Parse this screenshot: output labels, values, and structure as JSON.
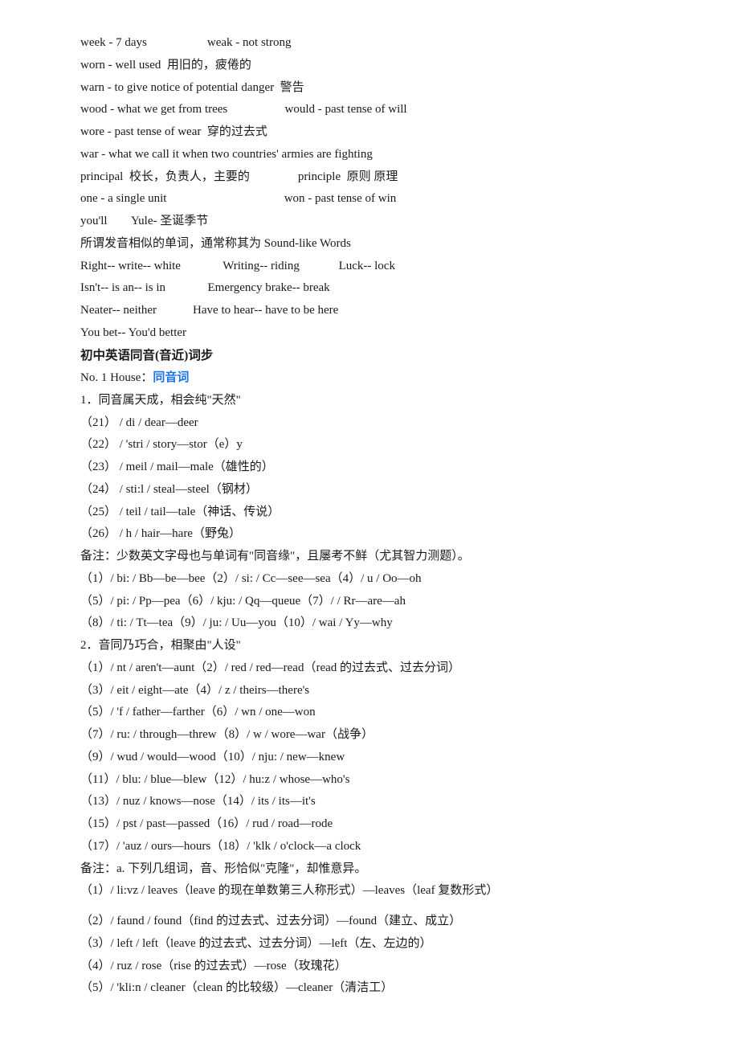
{
  "lines": [
    {
      "id": "l1",
      "text": "week - 7 days                    weak - not strong",
      "type": "normal"
    },
    {
      "id": "l2",
      "text": "worn - well used  用旧的，疲倦的",
      "type": "normal"
    },
    {
      "id": "l3",
      "text": "warn - to give notice of potential danger  警告",
      "type": "normal"
    },
    {
      "id": "l4",
      "text": "wood - what we get from trees                   would - past tense of will",
      "type": "normal"
    },
    {
      "id": "l5",
      "text": "wore - past tense of wear  穿的过去式",
      "type": "normal"
    },
    {
      "id": "l6",
      "text": "war - what we call it when two countries' armies are fighting",
      "type": "normal"
    },
    {
      "id": "l7",
      "text": "principal  校长，负责人，主要的                principle  原则 原理",
      "type": "normal"
    },
    {
      "id": "l8",
      "text": "one - a single unit                                       won - past tense of win",
      "type": "normal"
    },
    {
      "id": "l9",
      "text": "you'll        Yule- 圣诞季节",
      "type": "normal"
    },
    {
      "id": "l10",
      "text": "所谓发音相似的单词，通常称其为 Sound-like Words",
      "type": "normal"
    },
    {
      "id": "l11",
      "text": "Right-- write-- white              Writing-- riding             Luck-- lock",
      "type": "normal"
    },
    {
      "id": "l12",
      "text": "Isn't-- is an-- is in              Emergency brake-- break",
      "type": "normal"
    },
    {
      "id": "l13",
      "text": "Neater-- neither            Have to hear-- have to be here",
      "type": "normal"
    },
    {
      "id": "l14",
      "text": "You bet-- You'd better",
      "type": "normal"
    },
    {
      "id": "l15",
      "text": "初中英语同音(音近)词步",
      "type": "bold"
    },
    {
      "id": "l16",
      "text": "No. 1 House：同音词",
      "type": "normal_highlight"
    },
    {
      "id": "l17",
      "text": "1．同音属天成，相会纯\"天然\"",
      "type": "normal"
    },
    {
      "id": "l18",
      "text": "（21） / di / dear—deer",
      "type": "normal"
    },
    {
      "id": "l19",
      "text": "（22） / 'stri / story—stor（e）y",
      "type": "normal"
    },
    {
      "id": "l20",
      "text": "（23） / meil / mail—male（雄性的）",
      "type": "normal"
    },
    {
      "id": "l21",
      "text": "（24） / sti:l / steal—steel（钢材）",
      "type": "normal"
    },
    {
      "id": "l22",
      "text": "（25） / teil / tail—tale（神话、传说）",
      "type": "normal"
    },
    {
      "id": "l23",
      "text": "（26） / h / hair—hare（野兔）",
      "type": "normal"
    },
    {
      "id": "l24",
      "text": "备注：少数英文字母也与单词有\"同音缘\"，且屡考不鲜（尤其智力测题）。",
      "type": "normal"
    },
    {
      "id": "l25",
      "text": "（1）/ bi: / Bb—be—bee（2）/ si: / Cc—see—sea（4）/ u / Oo—oh",
      "type": "normal"
    },
    {
      "id": "l26",
      "text": "（5）/ pi: / Pp—pea（6）/ kju: / Qq—queue（7）/ / Rr—are—ah",
      "type": "normal"
    },
    {
      "id": "l27",
      "text": "（8）/ ti: / Tt—tea（9）/ ju: / Uu—you（10）/ wai / Yy—why",
      "type": "normal"
    },
    {
      "id": "l28",
      "text": "2．音同乃巧合，相聚由\"人设\"",
      "type": "normal"
    },
    {
      "id": "l29",
      "text": "（1）/ nt / aren't—aunt（2）/ red / red—read（read 的过去式、过去分词）",
      "type": "normal"
    },
    {
      "id": "l30",
      "text": "（3）/ eit / eight—ate（4）/ z / theirs—there's",
      "type": "normal"
    },
    {
      "id": "l31",
      "text": "（5）/ 'f / father—farther（6）/ wn / one—won",
      "type": "normal"
    },
    {
      "id": "l32",
      "text": "（7）/ ru: / through—threw（8）/ w / wore—war（战争）",
      "type": "normal"
    },
    {
      "id": "l33",
      "text": "（9）/ wud / would—wood（10）/ nju: / new—knew",
      "type": "normal"
    },
    {
      "id": "l34",
      "text": "（11）/ blu: / blue—blew（12）/ hu:z / whose—who's",
      "type": "normal"
    },
    {
      "id": "l35",
      "text": "（13）/ nuz / knows—nose（14）/ its / its—it's",
      "type": "normal"
    },
    {
      "id": "l36",
      "text": "（15）/ pst / past—passed（16）/ rud / road—rode",
      "type": "normal"
    },
    {
      "id": "l37",
      "text": "（17）/ 'auz / ours—hours（18）/ 'klk / o'clock—a clock",
      "type": "normal"
    },
    {
      "id": "l38",
      "text": "备注：a. 下列几组词，音、形恰似\"克隆\"，却惟意异。",
      "type": "normal"
    },
    {
      "id": "l39",
      "text": "（1）/ li:vz / leaves（leave 的现在单数第三人称形式）—leaves（leaf 复数形式）",
      "type": "normal"
    },
    {
      "id": "l40",
      "text": "",
      "type": "blank"
    },
    {
      "id": "l41",
      "text": "（2）/ faund / found（find 的过去式、过去分词）—found（建立、成立）",
      "type": "normal"
    },
    {
      "id": "l42",
      "text": "（3）/ left / left（leave 的过去式、过去分词）—left（左、左边的）",
      "type": "normal"
    },
    {
      "id": "l43",
      "text": "（4）/ ruz / rose（rise 的过去式）—rose（玫瑰花）",
      "type": "normal"
    },
    {
      "id": "l44",
      "text": "（5）/ 'kli:n / cleaner（clean 的比较级）—cleaner（清洁工）",
      "type": "normal"
    }
  ]
}
